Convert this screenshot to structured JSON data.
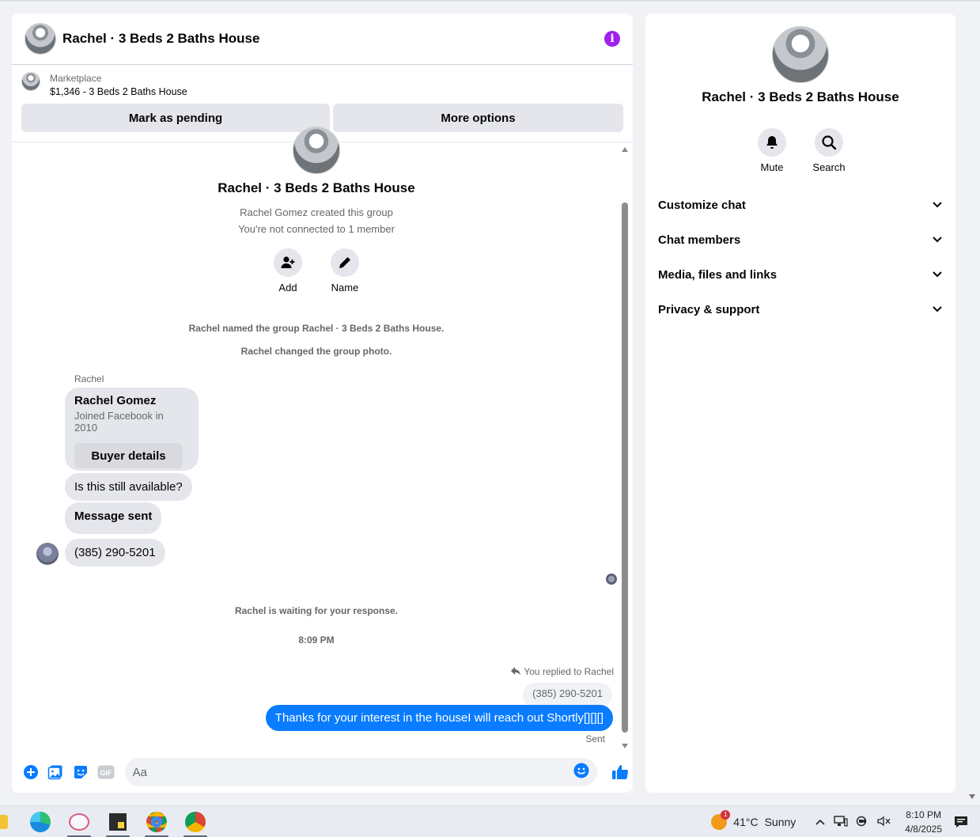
{
  "chat": {
    "title": "Rachel · 3 Beds 2 Baths House",
    "info_icon": "info-icon",
    "marketplace": {
      "label": "Marketplace",
      "listing": "$1,346 - 3 Beds 2 Baths House",
      "pending_label": "Mark as pending",
      "options_label": "More options"
    },
    "intro": {
      "title": "Rachel · 3 Beds 2 Baths House",
      "created": "Rachel Gomez created this group",
      "connection": "You're not connected to 1 member",
      "add_label": "Add",
      "name_label": "Name"
    },
    "system": {
      "named": "Rachel named the group Rachel · 3 Beds 2 Baths House.",
      "photo": "Rachel changed the group photo.",
      "waiting": "Rachel is waiting for your response.",
      "time": "8:09 PM"
    },
    "incoming": {
      "sender": "Rachel",
      "card_name": "Rachel Gomez",
      "card_sub": "Joined Facebook in 2010",
      "card_button": "Buyer details",
      "msg1": "Is this still available?",
      "msg2": "Message sent",
      "msg3": "(385) 290-5201"
    },
    "outgoing": {
      "reply_label": "You replied to Rachel",
      "quoted": "(385) 290-5201",
      "message": "Thanks for your interest in the houseI will reach out Shortly[][][]",
      "status": "Sent"
    },
    "composer": {
      "placeholder": "Aa"
    },
    "colors": {
      "accent": "#0a7cff",
      "info": "#a020f0"
    }
  },
  "info_panel": {
    "title": "Rachel · 3 Beds 2 Baths House",
    "mute_label": "Mute",
    "search_label": "Search",
    "sections": [
      "Customize chat",
      "Chat members",
      "Media, files and links",
      "Privacy & support"
    ]
  },
  "taskbar": {
    "weather_temp": "41°C",
    "weather_desc": "Sunny",
    "weather_badge": "1",
    "time": "8:10 PM",
    "date": "4/8/2025"
  }
}
